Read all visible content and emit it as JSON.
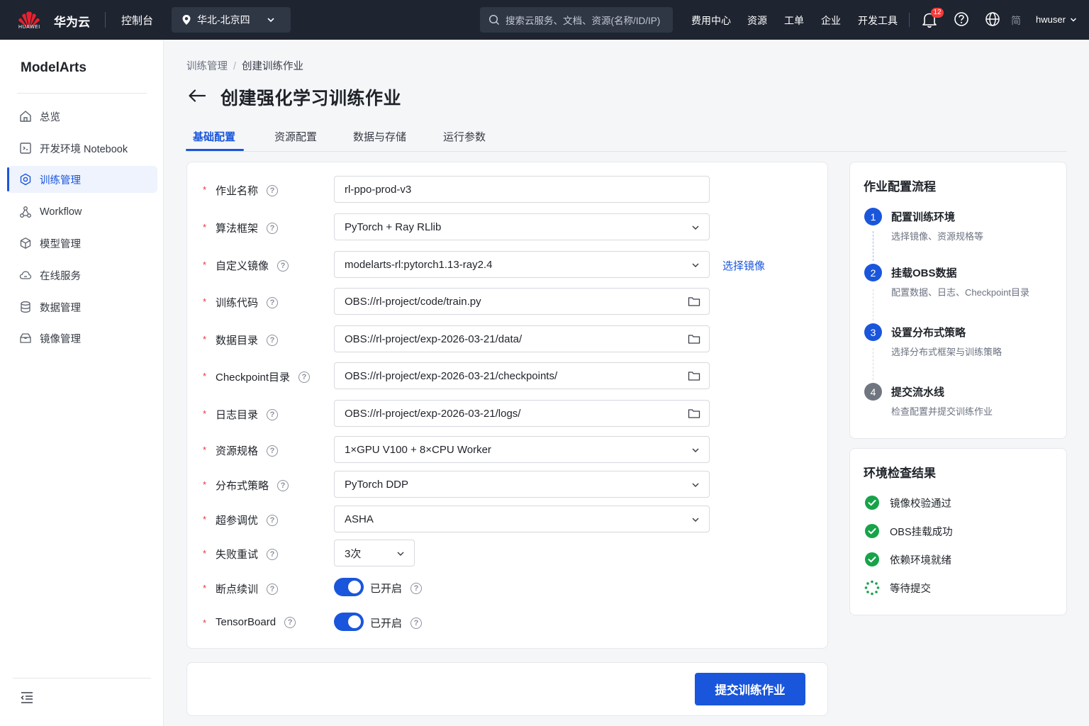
{
  "topbar": {
    "logo_text": "HUAWEI",
    "brand": "华为云",
    "console": "控制台",
    "region": "华北-北京四",
    "search_placeholder": "搜索云服务、文档、资源(名称/ID/IP)",
    "nav": [
      "费用中心",
      "资源",
      "工单",
      "企业",
      "开发工具"
    ],
    "notification_count": "12",
    "lang": "简",
    "user": "hwuser"
  },
  "sidebar": {
    "title": "ModelArts",
    "items": [
      {
        "label": "总览",
        "icon": "home-icon"
      },
      {
        "label": "开发环境 Notebook",
        "icon": "code-icon"
      },
      {
        "label": "训练管理",
        "icon": "training-icon"
      },
      {
        "label": "Workflow",
        "icon": "workflow-icon"
      },
      {
        "label": "模型管理",
        "icon": "cube-icon"
      },
      {
        "label": "在线服务",
        "icon": "cloud-icon"
      },
      {
        "label": "数据管理",
        "icon": "database-icon"
      },
      {
        "label": "镜像管理",
        "icon": "image-box-icon"
      }
    ],
    "active_index": 2
  },
  "breadcrumb": {
    "parent": "训练管理",
    "current": "创建训练作业"
  },
  "page_title": "创建强化学习训练作业",
  "tabs": [
    "基础配置",
    "资源配置",
    "数据与存储",
    "运行参数"
  ],
  "form": {
    "required_mark": "*",
    "help_glyph": "?",
    "job_name": {
      "label": "作业名称",
      "value": "rl-ppo-prod-v3"
    },
    "framework": {
      "label": "算法框架",
      "value": "PyTorch + Ray RLlib"
    },
    "image": {
      "label": "自定义镜像",
      "value": "modelarts-rl:pytorch1.13-ray2.4",
      "link": "选择镜像"
    },
    "code": {
      "label": "训练代码",
      "value": "OBS://rl-project/code/train.py"
    },
    "data_dir": {
      "label": "数据目录",
      "value": "OBS://rl-project/exp-2026-03-21/data/"
    },
    "ckpt_dir": {
      "label": "Checkpoint目录",
      "value": "OBS://rl-project/exp-2026-03-21/checkpoints/"
    },
    "log_dir": {
      "label": "日志目录",
      "value": "OBS://rl-project/exp-2026-03-21/logs/"
    },
    "resource": {
      "label": "资源规格",
      "value": "1×GPU V100 + 8×CPU Worker"
    },
    "strategy": {
      "label": "分布式策略",
      "value": "PyTorch DDP"
    },
    "hpo": {
      "label": "超参调优",
      "value": "ASHA"
    },
    "retry": {
      "label": "失败重试",
      "value": "3次"
    },
    "resume": {
      "label": "断点续训",
      "state": "已开启"
    },
    "tensorboard": {
      "label": "TensorBoard",
      "state": "已开启"
    }
  },
  "submit_label": "提交训练作业",
  "flow": {
    "title": "作业配置流程",
    "steps": [
      {
        "num": "1",
        "title": "配置训练环境",
        "desc": "选择镜像、资源规格等"
      },
      {
        "num": "2",
        "title": "挂载OBS数据",
        "desc": "配置数据、日志、Checkpoint目录"
      },
      {
        "num": "3",
        "title": "设置分布式策略",
        "desc": "选择分布式框架与训练策略"
      },
      {
        "num": "4",
        "title": "提交流水线",
        "desc": "检查配置并提交训练作业"
      }
    ]
  },
  "env": {
    "title": "环境检查结果",
    "items": [
      {
        "label": "镜像校验通过",
        "status": "passed"
      },
      {
        "label": "OBS挂载成功",
        "status": "passed"
      },
      {
        "label": "依赖环境就绪",
        "status": "passed"
      },
      {
        "label": "等待提交",
        "status": "pending"
      }
    ]
  },
  "colors": {
    "accent": "#1a56db",
    "topbar": "#1e2430",
    "success": "#17a34a",
    "required": "#e5383b"
  }
}
